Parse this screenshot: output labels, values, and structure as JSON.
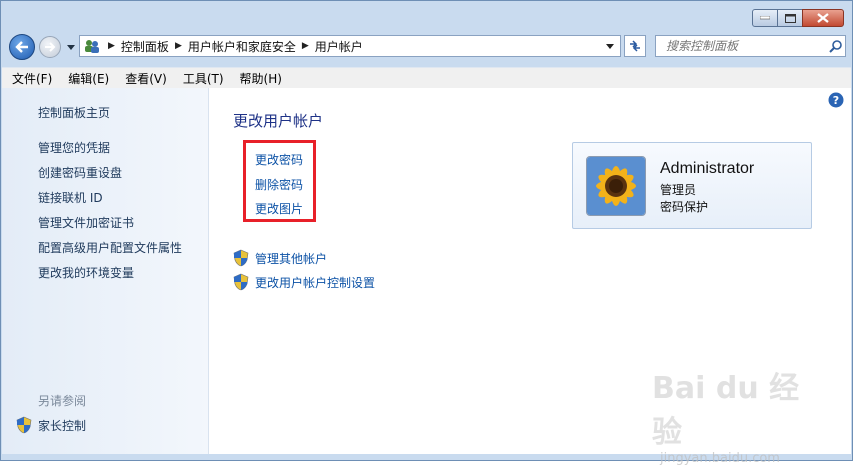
{
  "window": {
    "caption_buttons": [
      "minimize",
      "maximize",
      "close"
    ]
  },
  "navigation": {
    "breadcrumbs": [
      "控制面板",
      "用户帐户和家庭安全",
      "用户帐户"
    ],
    "search_placeholder": "搜索控制面板"
  },
  "menu": {
    "items": [
      "文件(F)",
      "编辑(E)",
      "查看(V)",
      "工具(T)",
      "帮助(H)"
    ]
  },
  "sidebar": {
    "home": "控制面板主页",
    "links": [
      "管理您的凭据",
      "创建密码重设盘",
      "链接联机 ID",
      "管理文件加密证书",
      "配置高级用户配置文件属性",
      "更改我的环境变量"
    ],
    "see_also_title": "另请参阅",
    "see_also_link": "家长控制"
  },
  "main": {
    "title": "更改用户帐户",
    "actions": [
      "更改密码",
      "删除密码",
      "更改图片"
    ],
    "shield_links": [
      "管理其他帐户",
      "更改用户帐户控制设置"
    ]
  },
  "user": {
    "name": "Administrator",
    "role": "管理员",
    "password_status": "密码保护"
  },
  "watermark": {
    "text": "Bai du 经验",
    "sub": "jingyan.baidu.com"
  }
}
